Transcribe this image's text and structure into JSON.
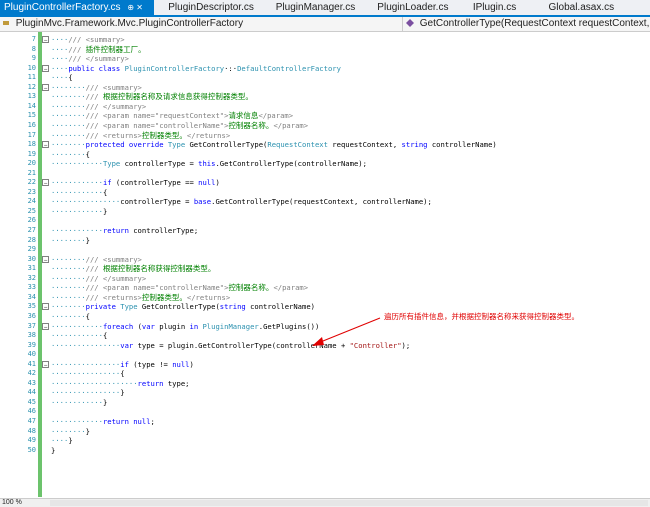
{
  "tabs": [
    {
      "label": "PluginControllerFactory.cs",
      "active": true,
      "controls": "⊕ ✕"
    },
    {
      "label": "PluginDescriptor.cs",
      "active": false
    },
    {
      "label": "PluginManager.cs",
      "active": false
    },
    {
      "label": "PluginLoader.cs",
      "active": false
    },
    {
      "label": "IPlugin.cs",
      "active": false
    },
    {
      "label": "Global.asax.cs",
      "active": false
    }
  ],
  "navbar": {
    "type_dropdown": "PluginMvc.Framework.Mvc.PluginControllerFactory",
    "member_dropdown": "GetControllerType(RequestContext requestContext, string"
  },
  "annotation": "遍历所有插件信息，并根据控制器名称来获得控制器类型。",
  "status": {
    "zoom": "100 %"
  },
  "colors": {
    "accent": "#007acc",
    "comment": "#008000",
    "keyword": "#0000ff",
    "type": "#2b91af",
    "string": "#a31515",
    "annotation": "#e00000"
  },
  "lines": [
    {
      "n": "7",
      "code": [
        [
          "dots",
          "····"
        ],
        [
          "xml",
          "/// <summary>"
        ]
      ]
    },
    {
      "n": "8",
      "code": [
        [
          "dots",
          "····"
        ],
        [
          "xml",
          "/// "
        ],
        [
          "cn",
          "插件控制器工厂。"
        ]
      ]
    },
    {
      "n": "9",
      "code": [
        [
          "dots",
          "····"
        ],
        [
          "xml",
          "/// </summary>"
        ]
      ]
    },
    {
      "n": "10",
      "code": [
        [
          "dots",
          "····"
        ],
        [
          "kw",
          "public class "
        ],
        [
          "typ",
          "PluginControllerFactory"
        ],
        [
          "",
          "·:·"
        ],
        [
          "typ",
          "DefaultControllerFactory"
        ]
      ]
    },
    {
      "n": "11",
      "code": [
        [
          "dots",
          "····"
        ],
        [
          "",
          "{"
        ]
      ]
    },
    {
      "n": "12",
      "code": [
        [
          "dots",
          "········"
        ],
        [
          "xml",
          "/// <summary>"
        ]
      ]
    },
    {
      "n": "13",
      "code": [
        [
          "dots",
          "········"
        ],
        [
          "xml",
          "/// "
        ],
        [
          "cn",
          "根据控制器名称及请求信息获得控制器类型。"
        ]
      ]
    },
    {
      "n": "14",
      "code": [
        [
          "dots",
          "········"
        ],
        [
          "xml",
          "/// </summary>"
        ]
      ]
    },
    {
      "n": "15",
      "code": [
        [
          "dots",
          "········"
        ],
        [
          "xml",
          "/// <param name=\"requestContext\">"
        ],
        [
          "cn",
          "请求信息"
        ],
        [
          "xml",
          "</param>"
        ]
      ]
    },
    {
      "n": "16",
      "code": [
        [
          "dots",
          "········"
        ],
        [
          "xml",
          "/// <param name=\"controllerName\">"
        ],
        [
          "cn",
          "控制器名称。"
        ],
        [
          "xml",
          "</param>"
        ]
      ]
    },
    {
      "n": "17",
      "code": [
        [
          "dots",
          "········"
        ],
        [
          "xml",
          "/// <returns>"
        ],
        [
          "cn",
          "控制器类型。"
        ],
        [
          "xml",
          "</returns>"
        ]
      ]
    },
    {
      "n": "18",
      "code": [
        [
          "dots",
          "········"
        ],
        [
          "kw",
          "protected override "
        ],
        [
          "typ",
          "Type "
        ],
        [
          "",
          "GetControllerType("
        ],
        [
          "typ",
          "RequestContext "
        ],
        [
          "",
          "requestContext, "
        ],
        [
          "kw",
          "string "
        ],
        [
          "",
          "controllerName)"
        ]
      ]
    },
    {
      "n": "19",
      "code": [
        [
          "dots",
          "········"
        ],
        [
          "",
          "{"
        ]
      ]
    },
    {
      "n": "20",
      "code": [
        [
          "dots",
          "············"
        ],
        [
          "typ",
          "Type "
        ],
        [
          "",
          "controllerType = "
        ],
        [
          "kw",
          "this"
        ],
        [
          "",
          ".GetControllerType(controllerName);"
        ]
      ]
    },
    {
      "n": "21",
      "code": []
    },
    {
      "n": "22",
      "code": [
        [
          "dots",
          "············"
        ],
        [
          "kw",
          "if "
        ],
        [
          "",
          "(controllerType == "
        ],
        [
          "kw",
          "null"
        ],
        [
          "",
          ")"
        ]
      ]
    },
    {
      "n": "23",
      "code": [
        [
          "dots",
          "············"
        ],
        [
          "",
          "{"
        ]
      ]
    },
    {
      "n": "24",
      "code": [
        [
          "dots",
          "················"
        ],
        [
          "",
          "controllerType = "
        ],
        [
          "kw",
          "base"
        ],
        [
          "",
          ".GetControllerType(requestContext, controllerName);"
        ]
      ]
    },
    {
      "n": "25",
      "code": [
        [
          "dots",
          "············"
        ],
        [
          "",
          "}"
        ]
      ]
    },
    {
      "n": "26",
      "code": []
    },
    {
      "n": "27",
      "code": [
        [
          "dots",
          "············"
        ],
        [
          "kw",
          "return "
        ],
        [
          "",
          "controllerType;"
        ]
      ]
    },
    {
      "n": "28",
      "code": [
        [
          "dots",
          "········"
        ],
        [
          "",
          "}"
        ]
      ]
    },
    {
      "n": "29",
      "code": []
    },
    {
      "n": "30",
      "code": [
        [
          "dots",
          "········"
        ],
        [
          "xml",
          "/// <summary>"
        ]
      ]
    },
    {
      "n": "31",
      "code": [
        [
          "dots",
          "········"
        ],
        [
          "xml",
          "/// "
        ],
        [
          "cn",
          "根据控制器名称获得控制器类型。"
        ]
      ]
    },
    {
      "n": "32",
      "code": [
        [
          "dots",
          "········"
        ],
        [
          "xml",
          "/// </summary>"
        ]
      ]
    },
    {
      "n": "33",
      "code": [
        [
          "dots",
          "········"
        ],
        [
          "xml",
          "/// <param name=\"controllerName\">"
        ],
        [
          "cn",
          "控制器名称。"
        ],
        [
          "xml",
          "</param>"
        ]
      ]
    },
    {
      "n": "34",
      "code": [
        [
          "dots",
          "········"
        ],
        [
          "xml",
          "/// <returns>"
        ],
        [
          "cn",
          "控制器类型。"
        ],
        [
          "xml",
          "</returns>"
        ]
      ]
    },
    {
      "n": "35",
      "code": [
        [
          "dots",
          "········"
        ],
        [
          "kw",
          "private "
        ],
        [
          "typ",
          "Type "
        ],
        [
          "",
          "GetControllerType("
        ],
        [
          "kw",
          "string "
        ],
        [
          "",
          "controllerName)"
        ]
      ]
    },
    {
      "n": "36",
      "code": [
        [
          "dots",
          "········"
        ],
        [
          "",
          "{"
        ]
      ]
    },
    {
      "n": "37",
      "code": [
        [
          "dots",
          "············"
        ],
        [
          "kw",
          "foreach "
        ],
        [
          "",
          "("
        ],
        [
          "kw",
          "var "
        ],
        [
          "",
          "plugin "
        ],
        [
          "kw",
          "in "
        ],
        [
          "typ",
          "PluginManager"
        ],
        [
          "",
          ".GetPlugins())"
        ]
      ]
    },
    {
      "n": "38",
      "code": [
        [
          "dots",
          "············"
        ],
        [
          "",
          "{"
        ]
      ]
    },
    {
      "n": "39",
      "code": [
        [
          "dots",
          "················"
        ],
        [
          "kw",
          "var "
        ],
        [
          "",
          "type = plugin.GetControllerType(controllerName + "
        ],
        [
          "str",
          "\"Controller\""
        ],
        [
          "",
          ");"
        ]
      ]
    },
    {
      "n": "40",
      "code": []
    },
    {
      "n": "41",
      "code": [
        [
          "dots",
          "················"
        ],
        [
          "kw",
          "if "
        ],
        [
          "",
          "(type != "
        ],
        [
          "kw",
          "null"
        ],
        [
          "",
          ")"
        ]
      ]
    },
    {
      "n": "42",
      "code": [
        [
          "dots",
          "················"
        ],
        [
          "",
          "{"
        ]
      ]
    },
    {
      "n": "43",
      "code": [
        [
          "dots",
          "····················"
        ],
        [
          "kw",
          "return "
        ],
        [
          "",
          "type;"
        ]
      ]
    },
    {
      "n": "44",
      "code": [
        [
          "dots",
          "················"
        ],
        [
          "",
          "}"
        ]
      ]
    },
    {
      "n": "45",
      "code": [
        [
          "dots",
          "············"
        ],
        [
          "",
          "}"
        ]
      ]
    },
    {
      "n": "46",
      "code": []
    },
    {
      "n": "47",
      "code": [
        [
          "dots",
          "············"
        ],
        [
          "kw",
          "return "
        ],
        [
          "kw",
          "null"
        ],
        [
          "",
          ";"
        ]
      ]
    },
    {
      "n": "48",
      "code": [
        [
          "dots",
          "········"
        ],
        [
          "",
          "}"
        ]
      ]
    },
    {
      "n": "49",
      "code": [
        [
          "dots",
          "····"
        ],
        [
          "",
          "}"
        ]
      ]
    },
    {
      "n": "50",
      "code": [
        [
          "",
          "}"
        ]
      ]
    }
  ]
}
